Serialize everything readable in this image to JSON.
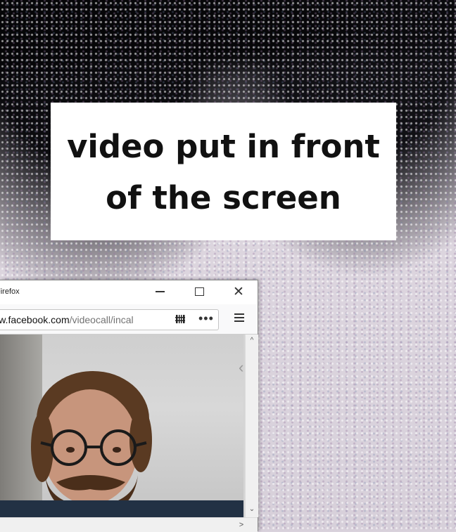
{
  "caption": {
    "text": "video put in front\nof the screen"
  },
  "browser": {
    "window_title": "Firefox",
    "url_domain": "www.facebook.com",
    "url_path": "/videocall/incal",
    "controls": {
      "minimize_icon": "minimize-icon",
      "maximize_icon": "maximize-icon",
      "close_icon": "close-icon",
      "close_glyph": "✕",
      "page_actions_glyph": "•••",
      "page_actions_icon": "more-icon",
      "menu_icon": "hamburger-icon",
      "reader_icon": "reader-mode-icon"
    },
    "scroll": {
      "up_glyph": "^",
      "down_glyph": "⌄",
      "right_glyph": ">"
    },
    "side_handle_glyph": "‹"
  },
  "colors": {
    "caption_bg": "#ffffff",
    "caption_text": "#111111",
    "browser_chrome": "#f9f9fa"
  }
}
